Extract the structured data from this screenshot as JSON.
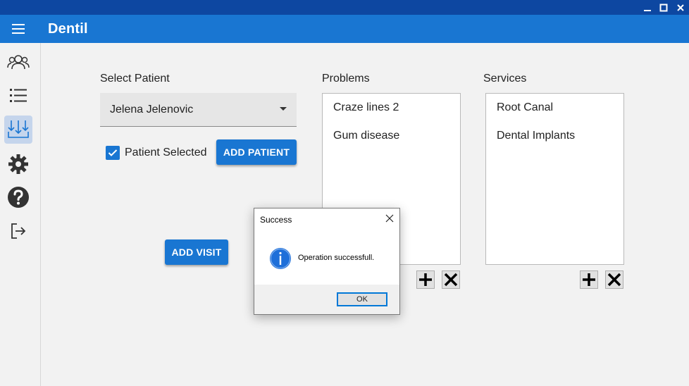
{
  "window": {
    "controls": [
      "minimize-icon",
      "maximize-icon",
      "close-icon"
    ]
  },
  "appbar": {
    "title": "Dentil",
    "menu_icon": "hamburger-menu-icon"
  },
  "sidebar": {
    "items": [
      {
        "icon": "patients-icon",
        "active": false
      },
      {
        "icon": "list-icon",
        "active": false
      },
      {
        "icon": "download-tray-icon",
        "active": true
      },
      {
        "icon": "gear-icon",
        "active": false
      },
      {
        "icon": "help-icon",
        "active": false
      },
      {
        "icon": "logout-icon",
        "active": false
      }
    ]
  },
  "patient": {
    "label": "Select Patient",
    "selected": "Jelena Jelenovic",
    "checkbox_label": "Patient Selected",
    "checkbox_checked": true,
    "add_patient_label": "ADD PATIENT",
    "add_visit_label": "ADD VISIT"
  },
  "problems": {
    "label": "Problems",
    "items": [
      "Craze lines 2",
      "Gum disease"
    ]
  },
  "services": {
    "label": "Services",
    "items": [
      "Root Canal",
      "Dental Implants"
    ]
  },
  "dialog": {
    "title": "Success",
    "message": "Operation successfull.",
    "ok_label": "OK",
    "icon": "info-icon"
  },
  "colors": {
    "accent": "#1976d2",
    "titlebar": "#0d47a1",
    "background": "#f2f2f2"
  }
}
